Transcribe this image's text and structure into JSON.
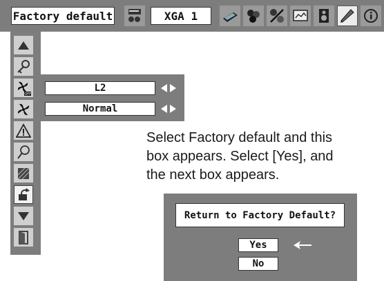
{
  "topbar": {
    "menu_title": "Factory default",
    "input_label": "XGA 1",
    "icons": [
      "projector-memory-icon",
      "laptop-icon",
      "color-balls-icon",
      "image-adjust-icon",
      "screen-icon",
      "speaker-icon",
      "settings-pencil-icon",
      "info-icon"
    ],
    "selected_icon": "settings-pencil-icon"
  },
  "left_menu": {
    "items": [
      "up-arrow-icon",
      "key-icon",
      "fan-off-icon",
      "fan-icon",
      "warning-icon",
      "lamp-icon",
      "filter-icon",
      "reset-icon",
      "down-arrow-icon",
      "exit-icon"
    ],
    "highlighted": "reset-icon"
  },
  "sub_menu": {
    "row1_value": "L2",
    "row2_value": "Normal"
  },
  "description": {
    "line1": "Select Factory default and this",
    "line2": "box appears. Select [Yes], and",
    "line3": "the next box appears."
  },
  "dialog": {
    "title": "Return to Factory Default?",
    "yes_label": "Yes",
    "no_label": "No"
  },
  "colors": {
    "panel_gray": "#7d7d7d",
    "icon_gray": "#cfcfcf",
    "text_dark": "#111111"
  }
}
